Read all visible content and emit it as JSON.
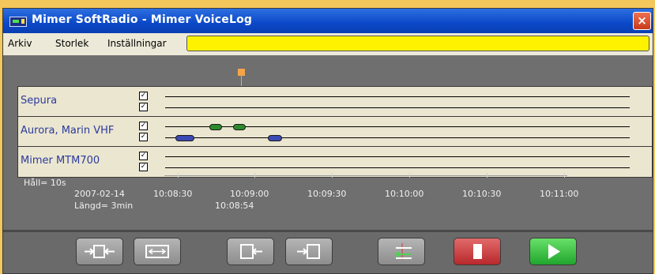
{
  "window": {
    "title": "Mimer SoftRadio - Mimer VoiceLog",
    "close_glyph": "×"
  },
  "menu": {
    "items": [
      {
        "label": "Arkiv"
      },
      {
        "label": "Storlek"
      },
      {
        "label": "Inställningar"
      }
    ],
    "status_bar_color": "#fff200"
  },
  "tracks": [
    {
      "name": "Sepura",
      "check1": "✓",
      "check2": "✓"
    },
    {
      "name": "Aurora, Marin VHF",
      "check1": "✓",
      "check2": "✓"
    },
    {
      "name": "Mimer MTM700",
      "check1": "✓",
      "check2": "✓"
    }
  ],
  "timeline": {
    "hold": "Håll= 10s",
    "date": "2007-02-14",
    "length": "Längd= 3min",
    "cursor_time": "10:08:54",
    "ticks": [
      "10:08:30",
      "10:09:00",
      "10:09:30",
      "10:10:00",
      "10:10:30",
      "10:11:00"
    ]
  },
  "colors": {
    "accent": "#f5a44a",
    "background": "#f3c75c",
    "green_segment": "#2c8a2c",
    "blue_segment": "#3c4ab5"
  },
  "toolbar": {
    "buttons": [
      {
        "icon": "zoom-in-icon"
      },
      {
        "icon": "zoom-out-icon"
      },
      {
        "icon": "step-back-icon"
      },
      {
        "icon": "step-forward-icon"
      },
      {
        "icon": "swap-icon"
      },
      {
        "icon": "stop-icon"
      },
      {
        "icon": "play-icon"
      }
    ]
  }
}
